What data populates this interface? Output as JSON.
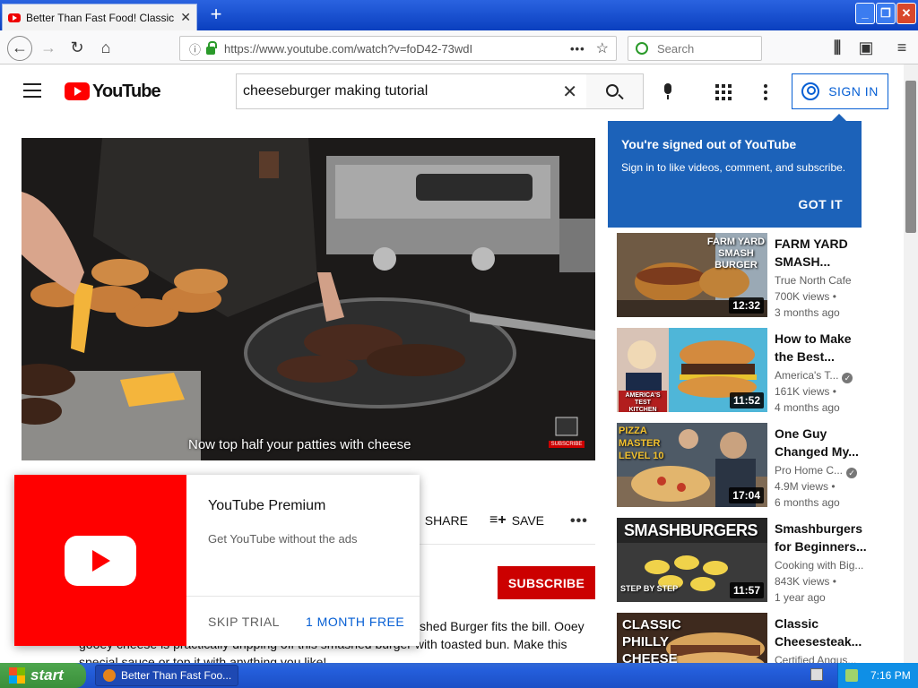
{
  "browser": {
    "tab_title": "Better Than Fast Food! Classic Sm",
    "url": "https://www.youtube.com/watch?v=foD42-73wdI",
    "search_placeholder": "Search",
    "new_tab_glyph": "+",
    "menu_dots": "•••"
  },
  "youtube": {
    "logo_text": "YouTube",
    "search_query": "cheeseburger making tutorial",
    "sign_in_label": "SIGN IN",
    "signed_out_card": {
      "title": "You're signed out of YouTube",
      "body": "Sign in to like videos, comment, and subscribe.",
      "button": "GOT IT"
    },
    "player": {
      "caption": "Now top half your patties with cheese",
      "watermark": "SUBSCRIBE"
    },
    "actions": {
      "share_label": "SHARE",
      "save_label": "SAVE",
      "more_label": "•••"
    },
    "subscribe_label": "SUBSCRIBE",
    "description": {
      "line1": "shed Burger fits the bill. Ooey",
      "line2": "gooey cheese is practically dripping off this smashed burger with toasted bun. Make this",
      "line3": "special sauce or top it with anything you like!"
    },
    "premium_popup": {
      "title": "YouTube Premium",
      "subtitle": "Get YouTube without the ads",
      "skip_label": "SKIP TRIAL",
      "cta_label": "1 MONTH FREE"
    },
    "related": [
      {
        "title": "FARM YARD SMASH...",
        "channel": "True North Cafe",
        "views": "700K views •",
        "age": "3 months ago",
        "duration": "12:32",
        "overlay": "FARM YARD SMASH BURGER",
        "verified": false
      },
      {
        "title": "How to Make the Best...",
        "channel": "America's T...",
        "views": "161K views •",
        "age": "4 months ago",
        "duration": "11:52",
        "overlay": "AMERICA'S TEST KITCHEN",
        "verified": true
      },
      {
        "title": "One Guy Changed My...",
        "channel": "Pro Home C...",
        "views": "4.9M views •",
        "age": "6 months ago",
        "duration": "17:04",
        "overlay": "PIZZA MASTER LEVEL 10",
        "verified": true
      },
      {
        "title": "Smashburgers for Beginners...",
        "channel": "Cooking with Big...",
        "views": "843K views •",
        "age": "1 year ago",
        "duration": "11:57",
        "overlay": "SMASHBURGERS",
        "overlay2": "STEP BY STEP",
        "verified": false
      },
      {
        "title": "Classic Cheesesteak...",
        "channel": "Certified Angus...",
        "views": "",
        "age": "",
        "duration": "",
        "overlay": "CLASSIC PHILLY CHEESE",
        "verified": false
      }
    ]
  },
  "taskbar": {
    "start_label": "start",
    "task_label": "Better Than Fast Foo...",
    "clock": "7:16 PM"
  }
}
